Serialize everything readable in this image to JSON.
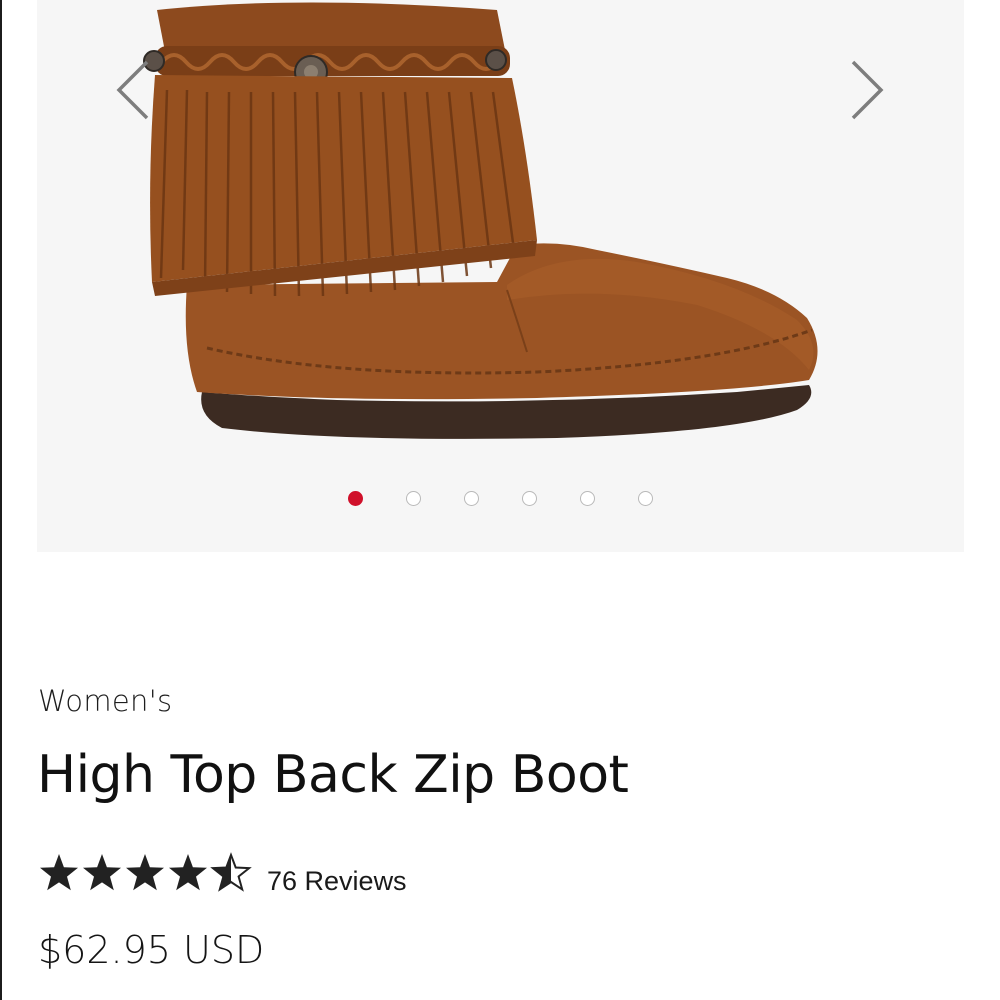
{
  "gallery": {
    "image_description_icon": "fringe-boot-image",
    "prev_icon": "chevron-left-icon",
    "next_icon": "chevron-right-icon",
    "slide_count": 6,
    "active_slide": 1,
    "active_dot_color": "#d0112b"
  },
  "product": {
    "category": "Women's",
    "title": "High Top Back Zip Boot",
    "rating_value": 4.5,
    "rating_max": 5,
    "reviews_label": "76 Reviews",
    "price": "$62.95 USD"
  }
}
